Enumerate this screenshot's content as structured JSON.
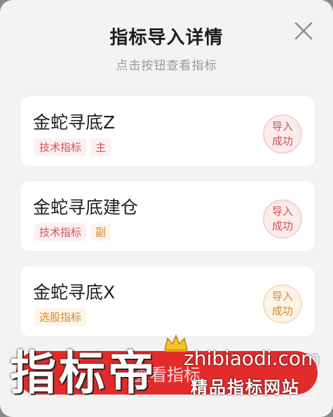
{
  "dialog": {
    "title": "指标导入详情",
    "subtitle": "点击按钮查看指标",
    "close_icon": "close-icon"
  },
  "items": [
    {
      "name": "金蛇寻底Z",
      "tags": [
        "技术指标",
        "主"
      ],
      "tag_color": "#d65151",
      "status": [
        "导入",
        "成功"
      ],
      "status_color": "#d65151"
    },
    {
      "name": "金蛇寻底建仓",
      "tags": [
        "技术指标",
        "副"
      ],
      "tag_color": "#d65151",
      "status": [
        "导入",
        "成功"
      ],
      "status_color": "#d65151"
    },
    {
      "name": "金蛇寻底X",
      "tags": [
        "选股指标"
      ],
      "tag_color": "#d68a2a",
      "status": [
        "导入",
        "成功"
      ],
      "status_color": "#d68a2a"
    }
  ],
  "action_button": {
    "label": "查看指标",
    "color": "#e42b2b"
  },
  "watermark": {
    "brand": "指标帝",
    "url": "zhibiaodi.com",
    "tagline": "精品指标网站",
    "crown_icon": "crown-icon"
  }
}
